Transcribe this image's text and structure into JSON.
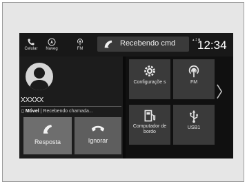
{
  "topbar": {
    "buttons": [
      {
        "label": "Celular",
        "icon": "phone-icon"
      },
      {
        "label": "Naveg",
        "icon": "navigation-icon"
      },
      {
        "label": "FM",
        "icon": "radio-icon"
      }
    ],
    "command_text": "Recebendo cmd",
    "clock": "12:34"
  },
  "call": {
    "contact_name": "XXXXX",
    "line_label": "Móvel",
    "status_text": "Recebendo chamada...",
    "answer_label": "Resposta",
    "ignore_label": "Ignorar"
  },
  "apps": [
    {
      "label": "Configuraçõe s",
      "icon": "gear-icon"
    },
    {
      "label": "FM",
      "icon": "radio-icon"
    },
    {
      "label": "Computador de bordo",
      "icon": "fuel-icon"
    },
    {
      "label": "USB1",
      "icon": "usb-icon"
    }
  ],
  "colors": {
    "screen_bg": "#0a0a0a",
    "tile_bg": "#3a3a3a",
    "answer_bg": "#6e6e6e",
    "ignore_bg": "#5e5e5e"
  }
}
